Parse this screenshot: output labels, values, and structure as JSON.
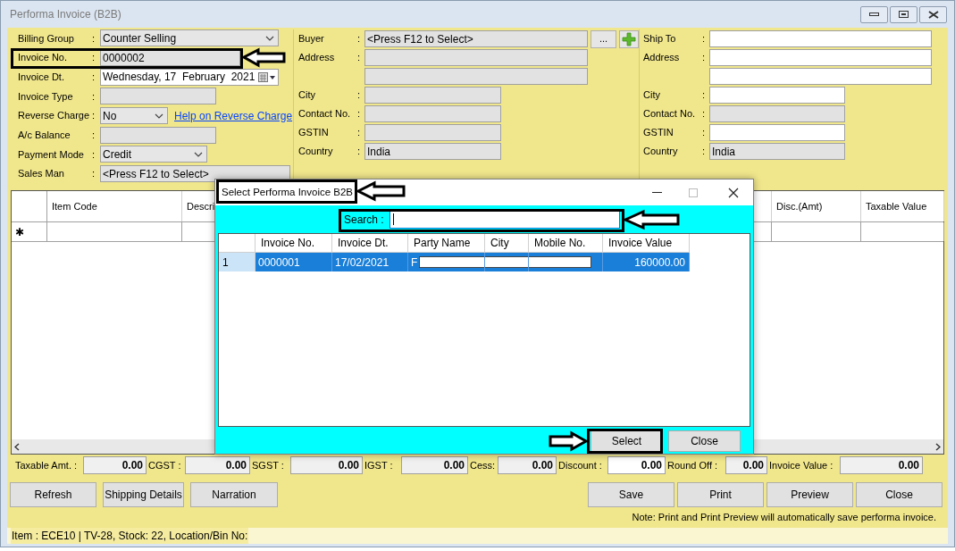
{
  "window": {
    "title": "Performa Invoice (B2B)"
  },
  "left_fields": [
    {
      "label": "Billing Group",
      "colon": ":",
      "kind": "dropdown",
      "value": "Counter Selling"
    },
    {
      "label": "Invoice No.",
      "colon": ":",
      "kind": "text",
      "value": "0000002",
      "readonly": true
    },
    {
      "label": "Invoice Dt.",
      "colon": ":",
      "kind": "date",
      "value": "Wednesday, 17  February  2021",
      "readonly": false
    },
    {
      "label": "Invoice Type",
      "colon": ":",
      "kind": "text",
      "readonly": true
    },
    {
      "label": "Reverse Charge",
      "colon": ":",
      "kind": "dropdown",
      "value": "No",
      "link": "Help on Reverse Charge"
    },
    {
      "label": "A/c Balance",
      "colon": ":",
      "kind": "text",
      "readonly": true
    },
    {
      "label": "Payment Mode",
      "colon": ":",
      "kind": "dropdown",
      "value": "Credit"
    },
    {
      "label": "Sales Man",
      "colon": ":",
      "kind": "text",
      "value": "<Press F12 to Select>",
      "readonly": true
    }
  ],
  "buyer_fields": [
    {
      "label": "Buyer",
      "colon": ":",
      "kind": "picker",
      "value": "<Press F12 to Select>",
      "readonly": true,
      "button": "..."
    },
    {
      "label": "Address",
      "colon": ":",
      "kind": "wide",
      "readonly": true
    },
    {
      "kind": "wide",
      "readonly": true
    },
    {
      "label": "City",
      "colon": ":",
      "kind": "text",
      "readonly": true
    },
    {
      "label": "Contact No.",
      "colon": ":",
      "kind": "text",
      "readonly": true
    },
    {
      "label": "GSTIN",
      "colon": ":",
      "kind": "text",
      "readonly": true
    },
    {
      "label": "Country",
      "colon": ":",
      "kind": "text",
      "value": "India",
      "readonly": true
    }
  ],
  "ship_fields": [
    {
      "label": "Ship To",
      "colon": ":",
      "kind": "wide",
      "readonly": false
    },
    {
      "label": "Address",
      "colon": ":",
      "kind": "wide",
      "readonly": false
    },
    {
      "kind": "wide",
      "readonly": false
    },
    {
      "label": "City",
      "colon": ":",
      "kind": "text",
      "readonly": false
    },
    {
      "label": "Contact No.",
      "colon": ":",
      "kind": "text",
      "readonly": true
    },
    {
      "label": "GSTIN",
      "colon": ":",
      "kind": "text",
      "readonly": false
    },
    {
      "label": "Country",
      "colon": ":",
      "kind": "text",
      "value": "India",
      "readonly": true
    }
  ],
  "items_grid": {
    "columns": [
      "Item Code",
      "Descri",
      "Disc.(Amt)",
      "Taxable Value"
    ],
    "new_row_marker": "✱"
  },
  "totals": [
    {
      "label": "Taxable Amt. :",
      "value": "0.00",
      "readonly": true
    },
    {
      "label": "CGST :",
      "value": "0.00",
      "readonly": true
    },
    {
      "label": "SGST :",
      "value": "0.00",
      "readonly": true
    },
    {
      "label": "IGST :",
      "value": "0.00",
      "readonly": true
    },
    {
      "label": "Cess:",
      "value": "0.00",
      "readonly": true
    },
    {
      "label": "Discount :",
      "value": "0.00",
      "readonly": false
    },
    {
      "label": "Round Off :",
      "value": "0.00",
      "readonly": true
    },
    {
      "label": "Invoice Value :",
      "value": "0.00",
      "readonly": true
    }
  ],
  "left_buttons": [
    "Refresh",
    "Shipping Details",
    "Narration"
  ],
  "right_buttons": [
    "Save",
    "Print",
    "Preview",
    "Close"
  ],
  "note": "Note: Print and Print Preview will automatically save performa invoice.",
  "status_bar": "Item : ECE10 | TV-28, Stock: 22, Location/Bin No:",
  "dialog": {
    "title": "Select Performa Invoice B2B",
    "search_label": "Search :",
    "columns": [
      "Invoice No.",
      "Invoice Dt.",
      "Party Name",
      "City",
      "Mobile No.",
      "Invoice Value"
    ],
    "rows": [
      {
        "row_header": "1",
        "invoice_no": "0000001",
        "invoice_dt": "17/02/2021",
        "party_name": "F",
        "invoice_value": "160000.00",
        "selected": true
      }
    ],
    "buttons": [
      "Select",
      "Close"
    ]
  }
}
